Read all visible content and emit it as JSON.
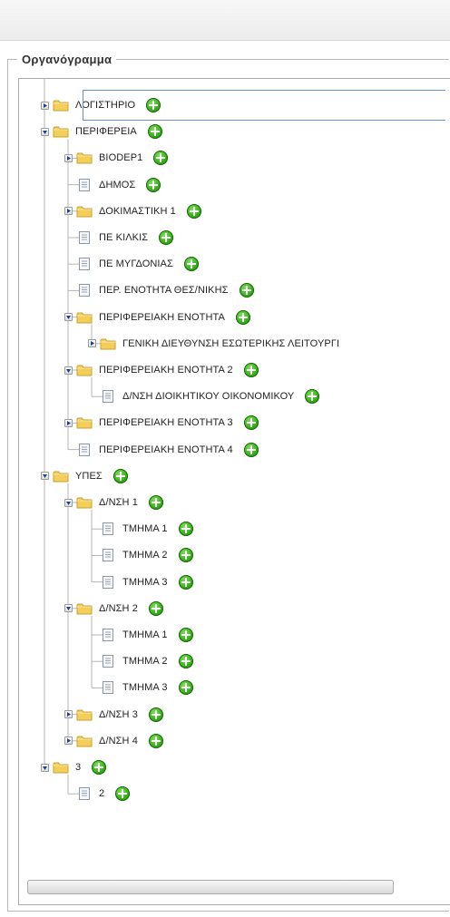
{
  "legend": "Οργανόγραμμα",
  "tree": [
    {
      "id": "n1",
      "label": "ΛΟΓΙΣΤΗΡΙΟ",
      "type": "folder",
      "toggle": "collapsed",
      "depth": 0
    },
    {
      "id": "n2",
      "label": "ΠΕΡΙΦΕΡΕΙΑ",
      "type": "folder",
      "toggle": "expanded",
      "depth": 0
    },
    {
      "id": "n3",
      "label": "BIODEP1",
      "type": "folder",
      "toggle": "collapsed",
      "depth": 1
    },
    {
      "id": "n4",
      "label": "ΔΗΜΟΣ",
      "type": "file",
      "depth": 1
    },
    {
      "id": "n5",
      "label": "ΔΟΚΙΜΑΣΤΙΚΗ 1",
      "type": "folder",
      "toggle": "collapsed",
      "depth": 1
    },
    {
      "id": "n6",
      "label": "ΠΕ ΚΙΛΚΙΣ",
      "type": "file",
      "depth": 1
    },
    {
      "id": "n7",
      "label": "ΠΕ ΜΥΓΔΟΝΙΑΣ",
      "type": "file",
      "depth": 1
    },
    {
      "id": "n8",
      "label": "ΠΕΡ. ΕΝΟΤΗΤΑ ΘΕΣ/ΝΙΚΗΣ",
      "type": "file",
      "depth": 1
    },
    {
      "id": "n9",
      "label": "ΠΕΡΙΦΕΡΕΙΑΚΗ ΕΝΟΤΗΤΑ",
      "type": "folder",
      "toggle": "expanded",
      "depth": 1
    },
    {
      "id": "n10",
      "label": "ΓΕΝΙΚΗ ΔΙΕΥΘΥΝΣΗ ΕΣΩΤΕΡΙΚΗΣ ΛΕΙΤΟΥΡΓΙ",
      "type": "folder",
      "toggle": "collapsed",
      "depth": 2,
      "noadd": true
    },
    {
      "id": "n11",
      "label": "ΠΕΡΙΦΕΡΕΙΑΚΗ ΕΝΟΤΗΤΑ 2",
      "type": "folder",
      "toggle": "expanded",
      "depth": 1
    },
    {
      "id": "n12",
      "label": "Δ/ΝΣΗ ΔΙΟΙΚΗΤΙΚΟΥ ΟΙΚΟΝΟΜΙΚΟΥ",
      "type": "file",
      "depth": 2
    },
    {
      "id": "n13",
      "label": "ΠΕΡΙΦΕΡΕΙΑΚΗ ΕΝΟΤΗΤΑ 3",
      "type": "folder",
      "toggle": "collapsed",
      "depth": 1
    },
    {
      "id": "n14",
      "label": "ΠΕΡΙΦΕΡΕΙΑΚΗ ΕΝΟΤΗΤΑ 4",
      "type": "file",
      "depth": 1
    },
    {
      "id": "n15",
      "label": "ΥΠΕΣ",
      "type": "folder",
      "toggle": "expanded",
      "depth": 0
    },
    {
      "id": "n16",
      "label": "Δ/ΝΣΗ 1",
      "type": "folder",
      "toggle": "expanded",
      "depth": 1
    },
    {
      "id": "n17",
      "label": "ΤΜΗΜΑ 1",
      "type": "file",
      "depth": 2
    },
    {
      "id": "n18",
      "label": "ΤΜΗΜΑ 2",
      "type": "file",
      "depth": 2
    },
    {
      "id": "n19",
      "label": "ΤΜΗΜΑ 3",
      "type": "file",
      "depth": 2
    },
    {
      "id": "n20",
      "label": "Δ/ΝΣΗ 2",
      "type": "folder",
      "toggle": "expanded",
      "depth": 1
    },
    {
      "id": "n21",
      "label": "ΤΜΗΜΑ 1",
      "type": "file",
      "depth": 2
    },
    {
      "id": "n22",
      "label": "ΤΜΗΜΑ 2",
      "type": "file",
      "depth": 2
    },
    {
      "id": "n23",
      "label": "ΤΜΗΜΑ 3",
      "type": "file",
      "depth": 2
    },
    {
      "id": "n24",
      "label": "Δ/ΝΣΗ 3",
      "type": "folder",
      "toggle": "collapsed",
      "depth": 1
    },
    {
      "id": "n25",
      "label": "Δ/ΝΣΗ 4",
      "type": "folder",
      "toggle": "collapsed",
      "depth": 1
    },
    {
      "id": "n26",
      "label": "3",
      "type": "folder",
      "toggle": "expanded",
      "depth": 0
    },
    {
      "id": "n27",
      "label": "2",
      "type": "file",
      "depth": 1
    }
  ],
  "icons": {
    "folder": "folder-icon",
    "file": "document-icon",
    "add": "add-circle-icon",
    "expand": "expand-toggle-icon",
    "collapse": "collapse-toggle-icon"
  },
  "colors": {
    "folder": "#f3cf5a",
    "add": "#35b018",
    "selection_border": "#6a8fc9"
  }
}
